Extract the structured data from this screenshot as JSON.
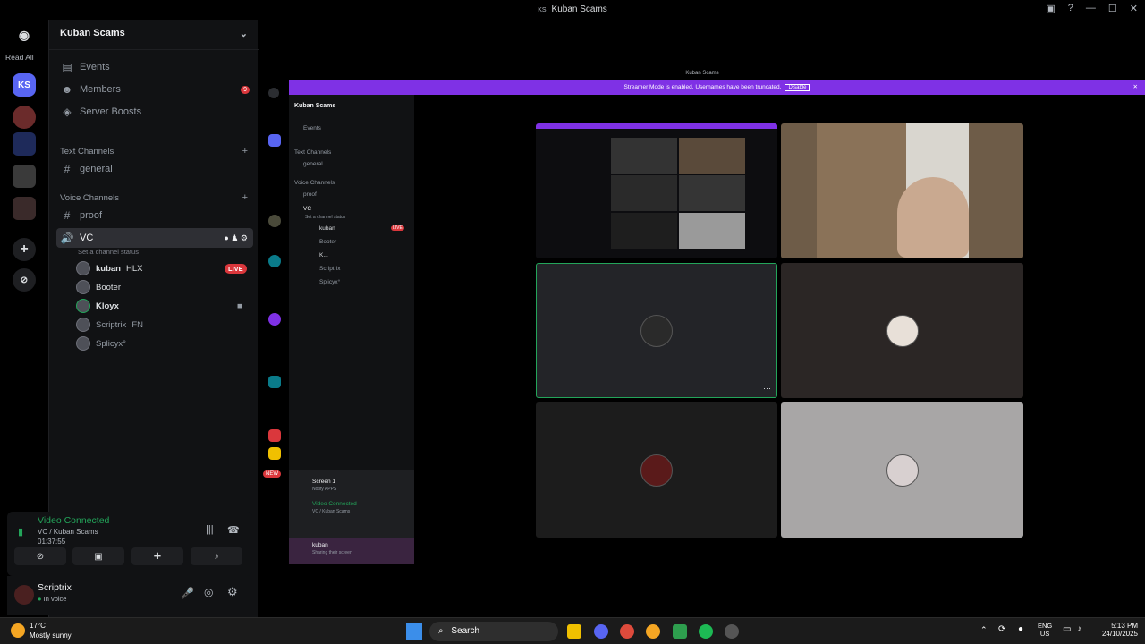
{
  "window": {
    "title": "Kuban Scams",
    "badge": "KS"
  },
  "guild_bar": {
    "read_all": "Read All",
    "server_badge": "KS"
  },
  "sidebar": {
    "server_name": "Kuban Scams",
    "events": "Events",
    "members": "Members",
    "members_count": "9",
    "server_boosts": "Server Boosts",
    "text_channels": "Text Channels",
    "general": "general",
    "voice_channels": "Voice Channels",
    "proof": "proof",
    "vc": "VC",
    "set_status": "Set a channel status",
    "users": [
      {
        "name": "kuban",
        "tag": "HLX",
        "live": "LIVE"
      },
      {
        "name": "Booter",
        "tag": ""
      },
      {
        "name": "Kloyx",
        "tag": ""
      },
      {
        "name": "Scriptrix",
        "tag": "FN"
      },
      {
        "name": "Splicyx°",
        "tag": ""
      }
    ]
  },
  "voice_panel": {
    "status": "Video Connected",
    "location": "VC / Kuban Scams",
    "timer": "01:37:55"
  },
  "user_bar": {
    "name": "Scriptrix",
    "status": "In voice"
  },
  "inner_window": {
    "title": "Kuban Scams",
    "banner_text": "Streamer Mode is enabled. Usernames have been truncated.",
    "banner_button": "Disable",
    "server_name": "Kuban Scams",
    "events": "Events",
    "text_channels": "Text Channels",
    "general": "general",
    "voice_channels": "Voice Channels",
    "proof": "proof",
    "vc": "VC",
    "set_status": "Set a channel status",
    "users": [
      "kuban",
      "Booter",
      "K...",
      "Scriptrix",
      "Splicyx°"
    ],
    "live": "LIVE",
    "new_badge": "NEW",
    "screen_label": "Screen 1",
    "screen_sub": "Notify APPS",
    "video_connected": "Video Connected",
    "video_location": "VC / Kuban Scams",
    "bottom_user": "kuban",
    "bottom_status": "Sharing their screen"
  },
  "taskbar": {
    "weather_temp": "17°C",
    "weather_desc": "Mostly sunny",
    "search": "Search",
    "lang": "ENG",
    "region": "US",
    "time": "5:13 PM",
    "date": "24/10/2025"
  },
  "colors": {
    "accent": "#5865f2",
    "green": "#23a55a",
    "live": "#da373c",
    "banner": "#7f31e5"
  }
}
